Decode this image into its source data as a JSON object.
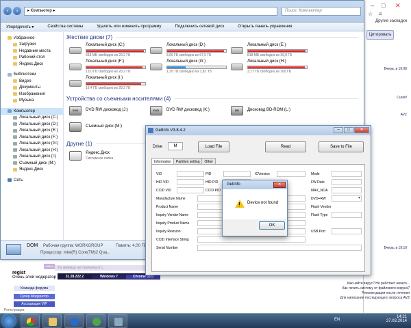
{
  "explorer": {
    "address": "▸ Компьютер ▸",
    "search_placeholder": "Поиск: Компьютер",
    "toolbar": [
      "Упорядочить ▾",
      "Свойства системы",
      "Удалить или изменить программу",
      "Подключить сетевой диск",
      "Открыть панель управления"
    ],
    "nav": [
      {
        "label": "Избранное",
        "icon": "star-icon",
        "sub": false
      },
      {
        "label": "Загрузки",
        "icon": "folder-icon",
        "sub": true
      },
      {
        "label": "Недавние места",
        "icon": "folder-icon",
        "sub": true
      },
      {
        "label": "Рабочий стол",
        "icon": "folder-icon",
        "sub": true
      },
      {
        "label": "Яндекс.Диск",
        "icon": "folder-icon",
        "sub": true
      },
      {
        "label": "",
        "gap": true
      },
      {
        "label": "Библиотеки",
        "icon": "library-icon",
        "sub": false
      },
      {
        "label": "Видео",
        "icon": "folder-icon",
        "sub": true
      },
      {
        "label": "Документы",
        "icon": "folder-icon",
        "sub": true
      },
      {
        "label": "Изображения",
        "icon": "folder-icon",
        "sub": true
      },
      {
        "label": "Музыка",
        "icon": "folder-icon",
        "sub": true
      },
      {
        "label": "",
        "gap": true
      },
      {
        "label": "Компьютер",
        "icon": "computer-icon",
        "sub": false,
        "selected": true
      },
      {
        "label": "Локальный диск (C:)",
        "icon": "drive-icon",
        "sub": true
      },
      {
        "label": "Локальный диск (D:)",
        "icon": "drive-icon",
        "sub": true
      },
      {
        "label": "Локальный диск (E:)",
        "icon": "drive-icon",
        "sub": true
      },
      {
        "label": "Локальный диск (F:)",
        "icon": "drive-icon",
        "sub": true
      },
      {
        "label": "Локальный диск (G:)",
        "icon": "drive-icon",
        "sub": true
      },
      {
        "label": "Локальный диск (H:)",
        "icon": "drive-icon",
        "sub": true
      },
      {
        "label": "Локальный диск (I:)",
        "icon": "drive-icon",
        "sub": true
      },
      {
        "label": "Съемный диск (M:)",
        "icon": "drive-icon",
        "sub": true
      },
      {
        "label": "Яндекс.Диск",
        "icon": "folder-icon",
        "sub": true
      },
      {
        "label": "",
        "gap": true
      },
      {
        "label": "Сеть",
        "icon": "network-icon",
        "sub": false
      }
    ],
    "groups": {
      "hdd": "Жесткие диски (7)",
      "removable": "Устройства со съемными носителями (4)",
      "other": "Другие (1)"
    },
    "drives": [
      {
        "name": "Локальный диск (C:)",
        "free": "663 МБ свободно из 29,2 ГБ",
        "used": 0.98,
        "color": "red"
      },
      {
        "name": "Локальный диск (D:)",
        "free": "3,09 ГБ свободно из 97,5 ГБ",
        "used": 0.97,
        "color": "red"
      },
      {
        "name": "Локальный диск (E:)",
        "free": "818 МБ свободно из 39,0 ГБ",
        "used": 0.98,
        "color": "red"
      },
      {
        "name": "Локальный диск (F:)",
        "free": "13,0 ГБ свободно из 29,2 ГБ",
        "used": 0.95,
        "color": "red"
      },
      {
        "name": "Локальный диск (G:)",
        "free": "1,25 ТБ свободно из 1,81 ТБ",
        "used": 0.31,
        "color": "blue"
      },
      {
        "name": "Локальный диск (H:)",
        "free": "3,17 ГБ свободно из 100 ГБ",
        "used": 0.97,
        "color": "red"
      },
      {
        "name": "Локальный диск (I:)",
        "free": "16,4 ГБ свободно из 29,2 ГБ",
        "used": 0.93,
        "color": "red"
      }
    ],
    "devices": [
      {
        "name": "DVD RW дисковод (J:)",
        "label": "DVD"
      },
      {
        "name": "DVD RW дисковод (K:)",
        "label": "DVD"
      },
      {
        "name": "Дисковод BD-ROM (L:)",
        "label": "BD"
      },
      {
        "name": "Съемный диск (M:)",
        "label": ""
      }
    ],
    "other": {
      "name": "Яндекс.Диск",
      "sub": "Системная папка"
    },
    "status": {
      "pc_name": "DOM",
      "workgroup": "Рабочая группа: WORKGROUP",
      "memory": "Память: 4,00 ГБ",
      "cpu": "Процессор: Intel(R) Core(TM)2 Qua..."
    }
  },
  "getinfo": {
    "title": "GetInfo V3.8.4.2",
    "drive_label": "Drive",
    "drive_value": "M",
    "load_btn": "Load File",
    "read_btn": "Read",
    "save_btn": "Save to File",
    "tabs": [
      "Information",
      "Partition setting",
      "Other"
    ],
    "fields": {
      "vid": "VID",
      "pid": "PID",
      "icversion": "ICVersion",
      "mode": "Mode",
      "hid_vid": "HID VID",
      "hid_pid": "HID PID",
      "fw_date": "FW Date",
      "ccid_vid": "CCID VID",
      "ccid_pid": "CCID PID",
      "max_noa": "MAX_NOA",
      "manufacture_name": "Manufacture Name",
      "dvd_rw": "DVD+RW",
      "product_name": "Product Name",
      "flash_vendor": "Flash Vendor",
      "inquiry_vendor": "Inquiry Vendor Name",
      "flash_type": "Flash Type",
      "inquiry_product": "Inquiry Product Name",
      "inquiry_revision": "Inquiry Revision",
      "usb_port": "USB Port",
      "ccid_interface": "CCID Interface String",
      "serial_number": "Serial Number"
    }
  },
  "dialog": {
    "title": "GetInfo",
    "message": "Device not found",
    "ok": "OK"
  },
  "browser": {
    "copy_btn": "Цитировать",
    "bookmarks": "Другие закладки",
    "user": "regist",
    "user_status": "Очень злой модератор",
    "rank1": "Команда форума",
    "rank2": "Супер Модератор",
    "rank3": "Ассоциация VIP",
    "registered": "Регистрация:",
    "sys_ip": "31.28.222.2",
    "sys_os": "Windows 7",
    "sys_browser": "Chrome 33.0",
    "stripe_text": "Ты можешь не считаться с...",
    "user_tag": "Offline",
    "right_texts": [
      "Вчера, в 19:06",
      "Cureit!",
      "AVZ",
      "Вчера, в 19:10"
    ],
    "list": [
      "Как найти вирус? Не работает ничего...",
      "Как лечить систему от файлового вируса?",
      "Рекомендации после лечения",
      "Для написания последующего вопроса AVZ"
    ]
  },
  "taskbar": {
    "lang": "EN",
    "time": "14:21",
    "date": "27.03.2014"
  }
}
